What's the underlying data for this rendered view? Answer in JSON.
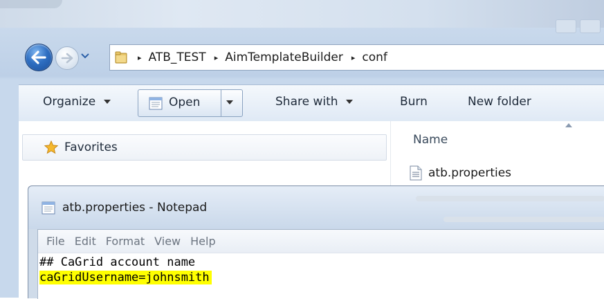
{
  "explorer": {
    "breadcrumb": [
      "ATB_TEST",
      "AimTemplateBuilder",
      "conf"
    ],
    "breadcrumb_separator": "▸",
    "toolbar": {
      "organize_label": "Organize",
      "open_label": "Open",
      "share_with_label": "Share with",
      "burn_label": "Burn",
      "new_folder_label": "New folder"
    },
    "nav_pane": {
      "favorites_label": "Favorites"
    },
    "file_list": {
      "column_name": "Name",
      "files": [
        {
          "name": "atb.properties",
          "icon": "text-file-icon"
        }
      ]
    }
  },
  "notepad": {
    "title": "atb.properties - Notepad",
    "menu": [
      "File",
      "Edit",
      "Format",
      "View",
      "Help"
    ],
    "lines": [
      {
        "text": "## CaGrid account name",
        "highlighted": false
      },
      {
        "text": "caGridUsername=johnsmith",
        "highlighted": true
      }
    ]
  },
  "colors": {
    "highlight": "#ffff00",
    "back_button": "#2f6fc2",
    "window_chrome": "#c9d9ec"
  }
}
